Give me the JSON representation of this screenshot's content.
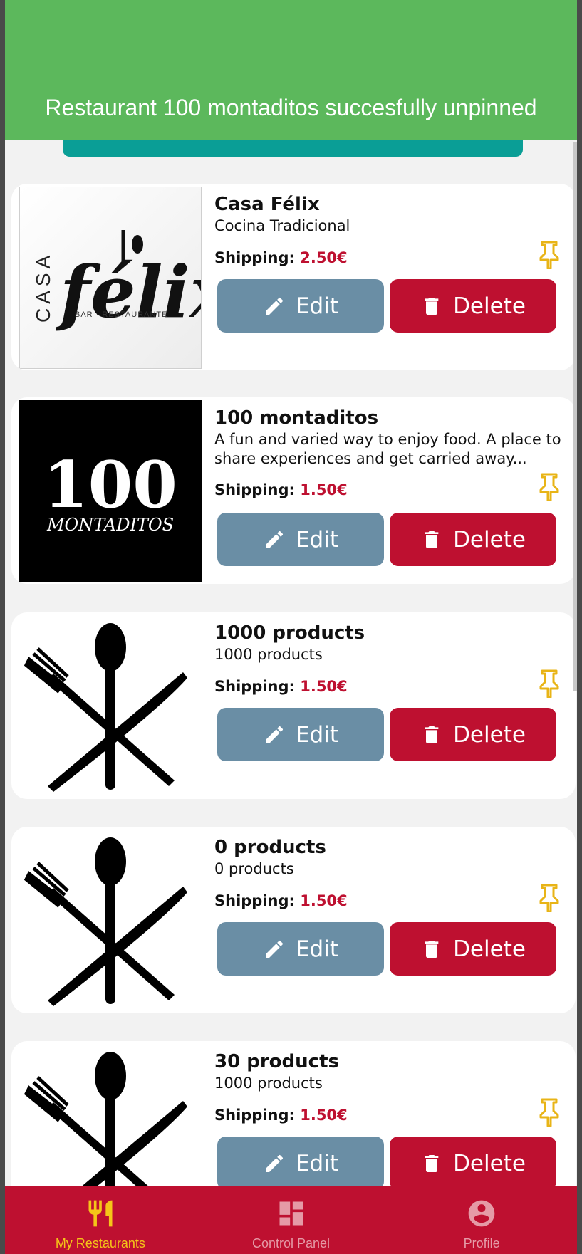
{
  "toast": {
    "message": "Restaurant 100 montaditos succesfully unpinned"
  },
  "labels": {
    "shipping": "Shipping:",
    "edit": "Edit",
    "delete": "Delete"
  },
  "restaurants": [
    {
      "name": "Casa Félix",
      "description": "Cocina Tradicional",
      "shipping": "2.50€",
      "logo": "casa-felix-logo"
    },
    {
      "name": "100 montaditos",
      "description": "A fun and varied way to enjoy food. A place to share experiences and get carried away...",
      "shipping": "1.50€",
      "logo": "100-montaditos-logo"
    },
    {
      "name": "1000 products",
      "description": "1000 products",
      "shipping": "1.50€",
      "logo": "cutlery-icon"
    },
    {
      "name": "0 products",
      "description": "0 products",
      "shipping": "1.50€",
      "logo": "cutlery-icon"
    },
    {
      "name": "30 products",
      "description": "1000 products",
      "shipping": "1.50€",
      "logo": "cutlery-icon"
    }
  ],
  "logos": {
    "casa_felix": {
      "word": "félix",
      "side": "CASA",
      "tagline": "BAR · RESTAURANTE"
    },
    "montaditos": {
      "number": "100",
      "word": "MONTADITOS"
    }
  },
  "nav": [
    {
      "label": "My Restaurants",
      "icon": "restaurant-icon",
      "active": true
    },
    {
      "label": "Control Panel",
      "icon": "dashboard-icon",
      "active": false
    },
    {
      "label": "Profile",
      "icon": "account-circle-icon",
      "active": false
    }
  ],
  "colors": {
    "toast": "#5cb85c",
    "brand": "#be1030",
    "edit": "#6a8ea5",
    "pin": "#e8b417",
    "nav_active": "#f5c518",
    "teal": "#0a9e96"
  }
}
